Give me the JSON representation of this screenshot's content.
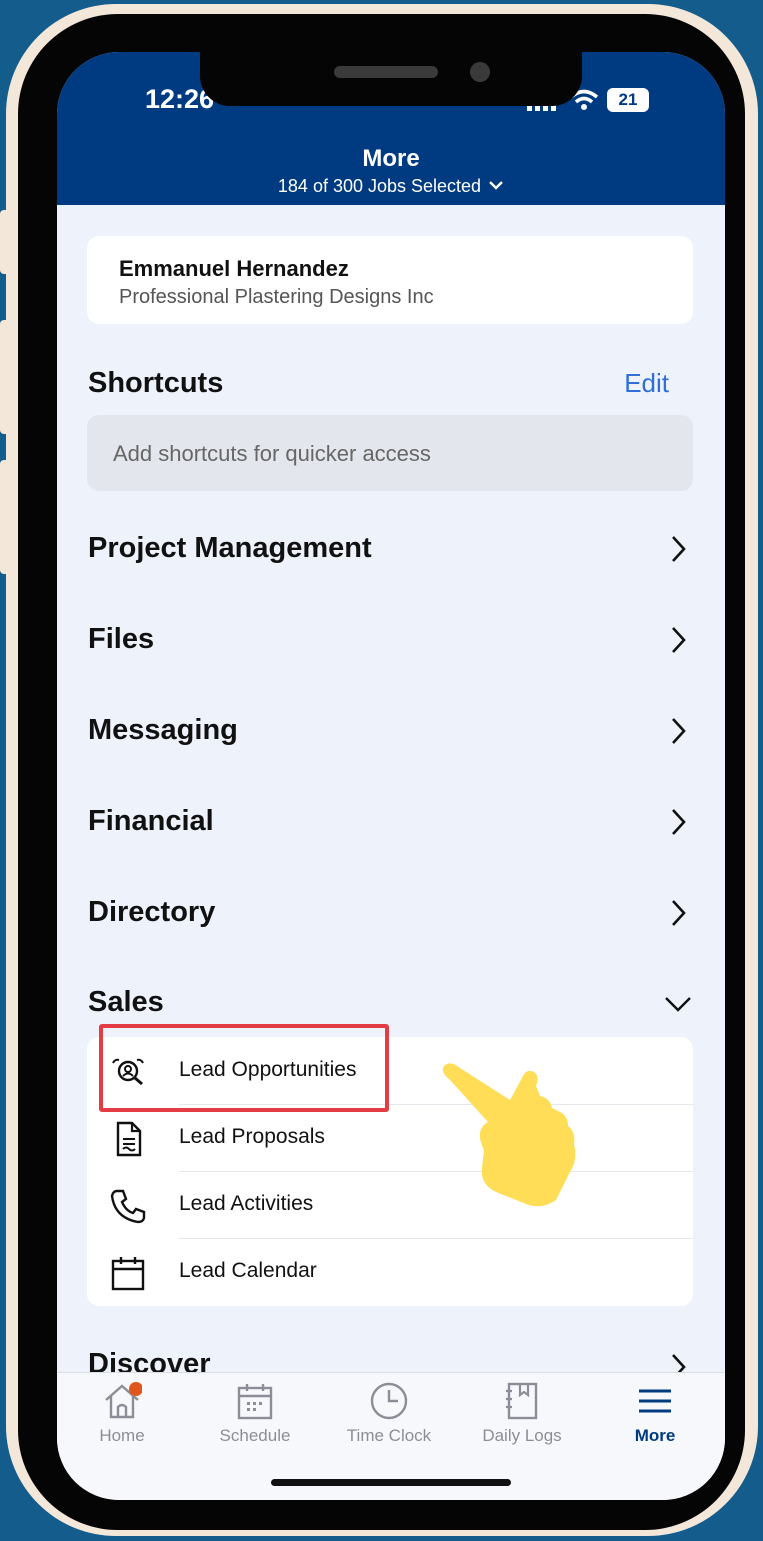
{
  "status": {
    "time": "12:26",
    "battery": "21"
  },
  "header": {
    "title": "More",
    "subtitle": "184 of 300 Jobs Selected"
  },
  "user": {
    "name": "Emmanuel  Hernandez",
    "company": "Professional Plastering Designs Inc"
  },
  "shortcuts": {
    "title": "Shortcuts",
    "edit_label": "Edit",
    "placeholder": "Add shortcuts for quicker access"
  },
  "sections": [
    {
      "label": "Project Management"
    },
    {
      "label": "Files"
    },
    {
      "label": "Messaging"
    },
    {
      "label": "Financial"
    },
    {
      "label": "Directory"
    },
    {
      "label": "Sales"
    }
  ],
  "sales_items": [
    {
      "label": "Lead Opportunities",
      "icon": "lead-opportunities-icon"
    },
    {
      "label": "Lead Proposals",
      "icon": "document-icon"
    },
    {
      "label": "Lead Activities",
      "icon": "phone-icon"
    },
    {
      "label": "Lead Calendar",
      "icon": "calendar-icon"
    }
  ],
  "discover": {
    "label": "Discover"
  },
  "tabs": [
    {
      "label": "Home",
      "icon": "home-icon"
    },
    {
      "label": "Schedule",
      "icon": "schedule-icon"
    },
    {
      "label": "Time Clock",
      "icon": "clock-icon"
    },
    {
      "label": "Daily Logs",
      "icon": "daily-logs-icon"
    },
    {
      "label": "More",
      "icon": "menu-icon",
      "active": true
    }
  ],
  "colors": {
    "header": "#003b82",
    "accent": "#2f6fd6",
    "highlight": "#e43c45",
    "pointer": "#ffdd57",
    "badge": "#e0561c"
  }
}
